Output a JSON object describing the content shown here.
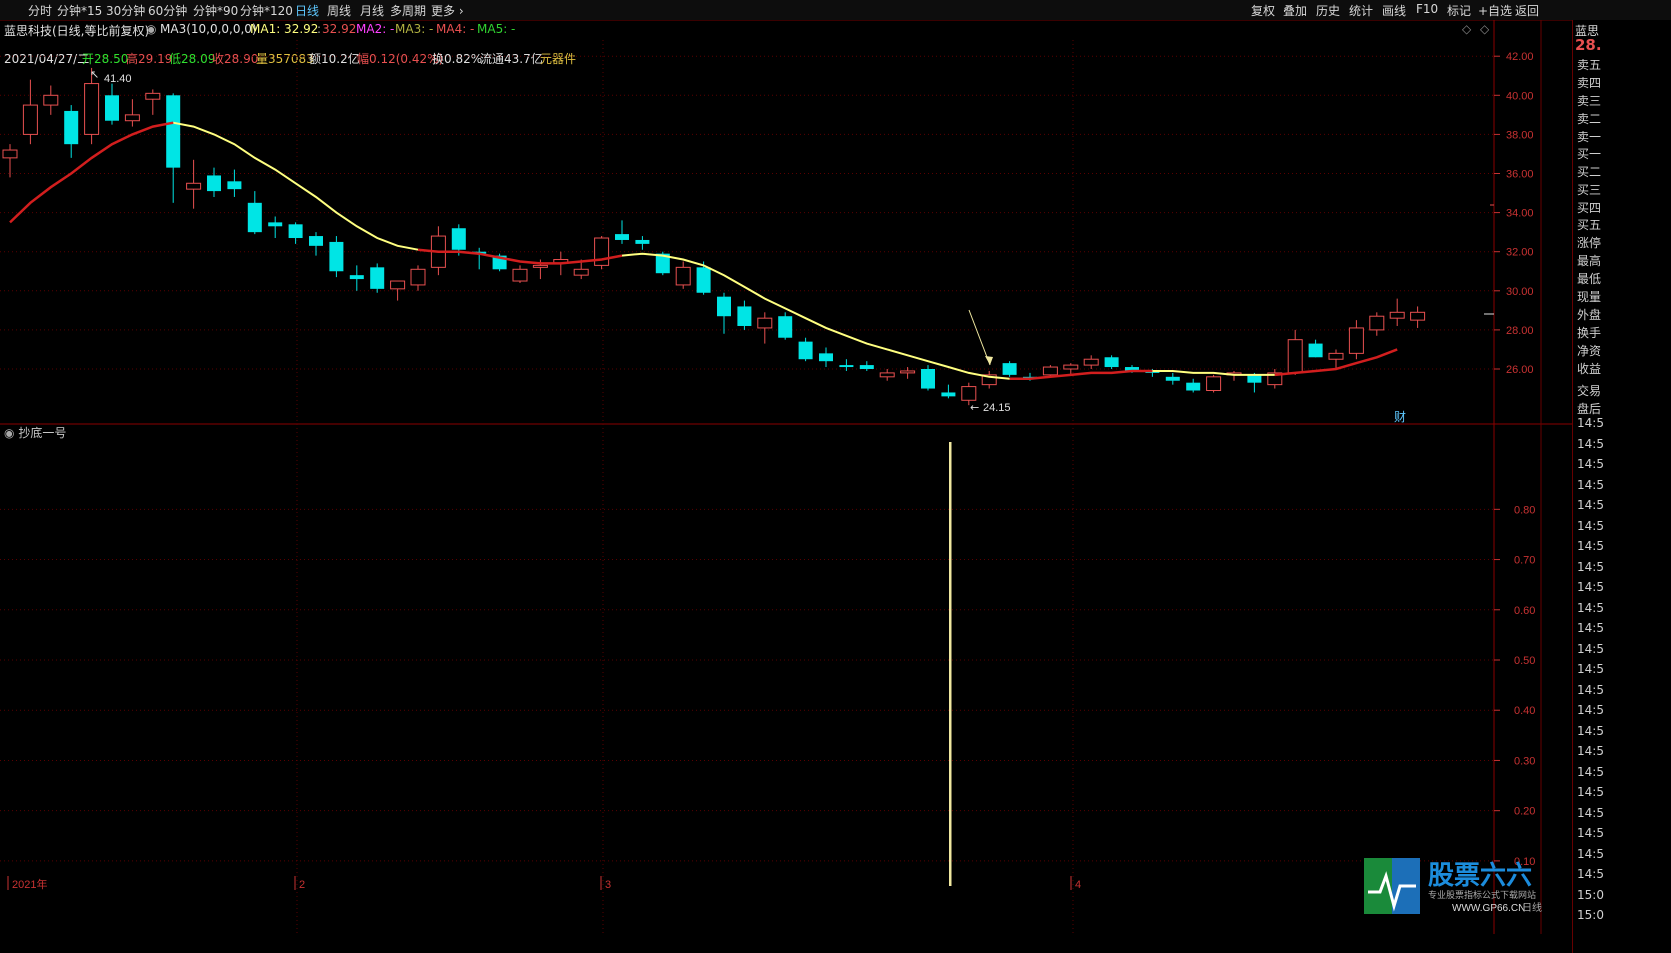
{
  "toolbar": {
    "left_items": [
      "分时",
      "分钟*15",
      "30分钟",
      "60分钟",
      "分钟*90",
      "分钟*120",
      "日线",
      "周线",
      "月线",
      "多周期",
      "更多 ›"
    ],
    "active": "日线",
    "right_items": [
      "复权",
      "叠加",
      "历史",
      "统计",
      "画线",
      "F10",
      "标记",
      "+自选",
      "返回"
    ]
  },
  "info": {
    "stock_name": "蓝思科技(日线,等比前复权)",
    "ma_name": "MA3(10,0,0,0,0)",
    "ma1": "MA1: 32.92",
    "ma1_val2": "32.92",
    "ma2": "MA2: -",
    "ma3": "MA3: -",
    "ma4": "MA4: -",
    "ma5": "MA5: -"
  },
  "ohlc": {
    "date": "2021/04/27/二",
    "open": "开28.50",
    "high": "高29.19",
    "low": "低28.09",
    "close": "收28.90",
    "volume": "量357083",
    "amount": "额10.2亿",
    "change": "幅0.12(0.42%)",
    "turnover": "换0.82%",
    "float": "流通43.7亿",
    "sector": "元器件"
  },
  "annotations": {
    "high_mark": "41.40",
    "low_mark": "24.15",
    "cai_label": "财"
  },
  "indicator": {
    "name": "抄底一号"
  },
  "x_axis": {
    "labels": [
      "2021年",
      "2",
      "3",
      "4"
    ]
  },
  "side_panel": {
    "title": "蓝思",
    "price": "28.",
    "rows": [
      "卖五",
      "卖四",
      "卖三",
      "卖二",
      "卖一",
      "买一",
      "买二",
      "买三",
      "买四",
      "买五",
      "涨停",
      "最高",
      "最低",
      "现量",
      "外盘",
      "换手",
      "净资",
      "收益",
      "交易",
      "盘后"
    ],
    "times": [
      "14:5",
      "14:5",
      "14:5",
      "14:5",
      "14:5",
      "14:5",
      "14:5",
      "14:5",
      "14:5",
      "14:5",
      "14:5",
      "14:5",
      "14:5",
      "14:5",
      "14:5",
      "14:5",
      "14:5",
      "14:5",
      "14:5",
      "14:5",
      "14:5",
      "14:5",
      "14:5",
      "15:0",
      "15:0"
    ]
  },
  "logo": {
    "text": "股票六六",
    "sub": "专业股票指标公式下载网站",
    "url": "WWW.GP66.CN",
    "badge": "日线"
  },
  "colors": {
    "up": "#e85050",
    "down": "#00e5e5",
    "ma_yellow": "#ffff80",
    "ma_red": "#d21e1e",
    "axis": "#c83232",
    "grid": "#5a0000"
  },
  "chart_data": [
    {
      "type": "candlestick",
      "title": "",
      "ylim": [
        24,
        43
      ],
      "y_ticks": [
        26,
        28,
        30,
        32,
        34,
        36,
        38,
        40,
        42
      ],
      "y_tick_labels": [
        "26.00",
        "28.00",
        "30.00",
        "32.00",
        "34.00",
        "36.00",
        "38.00",
        "40.00",
        "42.00"
      ],
      "candles": [
        {
          "o": 36.8,
          "h": 37.5,
          "l": 35.8,
          "c": 37.2
        },
        {
          "o": 38.0,
          "h": 40.8,
          "l": 37.5,
          "c": 39.5
        },
        {
          "o": 39.5,
          "h": 40.5,
          "l": 39.0,
          "c": 40.0
        },
        {
          "o": 39.2,
          "h": 39.5,
          "l": 36.8,
          "c": 37.5
        },
        {
          "o": 38.0,
          "h": 41.4,
          "l": 37.5,
          "c": 40.6
        },
        {
          "o": 40.0,
          "h": 40.6,
          "l": 38.5,
          "c": 38.7
        },
        {
          "o": 38.7,
          "h": 39.8,
          "l": 38.4,
          "c": 39.0
        },
        {
          "o": 39.8,
          "h": 40.3,
          "l": 39.0,
          "c": 40.1
        },
        {
          "o": 40.0,
          "h": 40.1,
          "l": 34.5,
          "c": 36.3
        },
        {
          "o": 35.2,
          "h": 36.7,
          "l": 34.2,
          "c": 35.5
        },
        {
          "o": 35.9,
          "h": 36.3,
          "l": 34.8,
          "c": 35.1
        },
        {
          "o": 35.6,
          "h": 36.2,
          "l": 34.8,
          "c": 35.2
        },
        {
          "o": 34.5,
          "h": 35.1,
          "l": 32.9,
          "c": 33.0
        },
        {
          "o": 33.5,
          "h": 33.8,
          "l": 32.7,
          "c": 33.3
        },
        {
          "o": 33.4,
          "h": 33.5,
          "l": 32.4,
          "c": 32.7
        },
        {
          "o": 32.8,
          "h": 33.0,
          "l": 31.8,
          "c": 32.3
        },
        {
          "o": 32.5,
          "h": 32.8,
          "l": 30.7,
          "c": 31.0
        },
        {
          "o": 30.8,
          "h": 31.3,
          "l": 30.0,
          "c": 30.6
        },
        {
          "o": 31.2,
          "h": 31.4,
          "l": 29.9,
          "c": 30.1
        },
        {
          "o": 30.1,
          "h": 30.5,
          "l": 29.5,
          "c": 30.5
        },
        {
          "o": 30.3,
          "h": 31.3,
          "l": 30.0,
          "c": 31.1
        },
        {
          "o": 31.2,
          "h": 33.3,
          "l": 30.8,
          "c": 32.8
        },
        {
          "o": 33.2,
          "h": 33.4,
          "l": 31.8,
          "c": 32.1
        },
        {
          "o": 32.0,
          "h": 32.2,
          "l": 31.1,
          "c": 31.9
        },
        {
          "o": 31.8,
          "h": 31.9,
          "l": 31.0,
          "c": 31.1
        },
        {
          "o": 30.5,
          "h": 31.3,
          "l": 30.4,
          "c": 31.1
        },
        {
          "o": 31.2,
          "h": 31.6,
          "l": 30.6,
          "c": 31.3
        },
        {
          "o": 31.4,
          "h": 32.0,
          "l": 30.8,
          "c": 31.6
        },
        {
          "o": 30.8,
          "h": 31.6,
          "l": 30.6,
          "c": 31.1
        },
        {
          "o": 31.3,
          "h": 32.8,
          "l": 31.1,
          "c": 32.7
        },
        {
          "o": 32.9,
          "h": 33.6,
          "l": 32.4,
          "c": 32.6
        },
        {
          "o": 32.6,
          "h": 32.8,
          "l": 32.1,
          "c": 32.4
        },
        {
          "o": 31.9,
          "h": 32.0,
          "l": 30.8,
          "c": 30.9
        },
        {
          "o": 30.3,
          "h": 31.5,
          "l": 30.1,
          "c": 31.2
        },
        {
          "o": 31.2,
          "h": 31.5,
          "l": 29.8,
          "c": 29.9
        },
        {
          "o": 29.7,
          "h": 29.9,
          "l": 27.8,
          "c": 28.7
        },
        {
          "o": 29.2,
          "h": 29.5,
          "l": 28.0,
          "c": 28.2
        },
        {
          "o": 28.1,
          "h": 28.9,
          "l": 27.3,
          "c": 28.6
        },
        {
          "o": 28.7,
          "h": 28.9,
          "l": 27.5,
          "c": 27.6
        },
        {
          "o": 27.4,
          "h": 27.6,
          "l": 26.4,
          "c": 26.5
        },
        {
          "o": 26.8,
          "h": 27.1,
          "l": 26.1,
          "c": 26.4
        },
        {
          "o": 26.2,
          "h": 26.5,
          "l": 25.9,
          "c": 26.1
        },
        {
          "o": 26.2,
          "h": 26.4,
          "l": 25.9,
          "c": 26.0
        },
        {
          "o": 25.6,
          "h": 26.0,
          "l": 25.4,
          "c": 25.8
        },
        {
          "o": 25.8,
          "h": 26.1,
          "l": 25.5,
          "c": 25.9
        },
        {
          "o": 26.0,
          "h": 26.2,
          "l": 24.9,
          "c": 25.0
        },
        {
          "o": 24.8,
          "h": 25.2,
          "l": 24.5,
          "c": 24.6
        },
        {
          "o": 24.4,
          "h": 25.3,
          "l": 24.15,
          "c": 25.1
        },
        {
          "o": 25.2,
          "h": 25.9,
          "l": 25.0,
          "c": 25.7
        },
        {
          "o": 26.3,
          "h": 26.4,
          "l": 25.6,
          "c": 25.7
        },
        {
          "o": 25.6,
          "h": 25.8,
          "l": 25.4,
          "c": 25.5
        },
        {
          "o": 25.7,
          "h": 26.2,
          "l": 25.6,
          "c": 26.1
        },
        {
          "o": 26.0,
          "h": 26.3,
          "l": 25.7,
          "c": 26.2
        },
        {
          "o": 26.2,
          "h": 26.7,
          "l": 26.0,
          "c": 26.5
        },
        {
          "o": 26.6,
          "h": 26.7,
          "l": 26.0,
          "c": 26.1
        },
        {
          "o": 26.1,
          "h": 26.2,
          "l": 25.8,
          "c": 25.9
        },
        {
          "o": 25.9,
          "h": 26.0,
          "l": 25.6,
          "c": 25.8
        },
        {
          "o": 25.6,
          "h": 25.8,
          "l": 25.2,
          "c": 25.4
        },
        {
          "o": 25.3,
          "h": 25.5,
          "l": 24.8,
          "c": 24.9
        },
        {
          "o": 24.9,
          "h": 25.7,
          "l": 24.8,
          "c": 25.6
        },
        {
          "o": 25.7,
          "h": 25.9,
          "l": 25.4,
          "c": 25.8
        },
        {
          "o": 25.7,
          "h": 25.8,
          "l": 24.8,
          "c": 25.3
        },
        {
          "o": 25.2,
          "h": 26.0,
          "l": 25.0,
          "c": 25.8
        },
        {
          "o": 25.8,
          "h": 28.0,
          "l": 25.7,
          "c": 27.5
        },
        {
          "o": 27.3,
          "h": 27.5,
          "l": 26.6,
          "c": 26.6
        },
        {
          "o": 26.5,
          "h": 27.0,
          "l": 26.0,
          "c": 26.8
        },
        {
          "o": 26.8,
          "h": 28.5,
          "l": 26.5,
          "c": 28.1
        },
        {
          "o": 28.0,
          "h": 28.9,
          "l": 27.7,
          "c": 28.7
        },
        {
          "o": 28.6,
          "h": 29.6,
          "l": 28.2,
          "c": 28.9
        },
        {
          "o": 28.5,
          "h": 29.2,
          "l": 28.1,
          "c": 28.9
        }
      ],
      "ma_line": [
        33.5,
        34.5,
        35.3,
        36.0,
        36.8,
        37.5,
        38.0,
        38.4,
        38.6,
        38.4,
        38.0,
        37.5,
        36.8,
        36.2,
        35.5,
        34.8,
        34.0,
        33.3,
        32.7,
        32.3,
        32.1,
        32.0,
        32.0,
        31.9,
        31.7,
        31.5,
        31.4,
        31.4,
        31.5,
        31.6,
        31.8,
        31.9,
        31.8,
        31.6,
        31.3,
        30.8,
        30.2,
        29.6,
        29.1,
        28.6,
        28.1,
        27.7,
        27.3,
        27.0,
        26.7,
        26.4,
        26.1,
        25.8,
        25.6,
        25.5,
        25.5,
        25.6,
        25.7,
        25.8,
        25.8,
        25.9,
        25.9,
        25.9,
        25.8,
        25.8,
        25.7,
        25.7,
        25.7,
        25.8,
        25.9,
        26.0,
        26.3,
        26.6,
        27.0
      ]
    },
    {
      "type": "bar",
      "title": "",
      "ylim": [
        0.05,
        0.95
      ],
      "y_ticks": [
        0.1,
        0.2,
        0.3,
        0.4,
        0.5,
        0.6,
        0.7,
        0.8
      ],
      "y_tick_labels": [
        "0.10",
        "0.20",
        "0.30",
        "0.40",
        "0.50",
        "0.60",
        "0.70",
        "0.80"
      ],
      "signals": [
        {
          "index": 46,
          "value": 1.0
        }
      ]
    }
  ]
}
